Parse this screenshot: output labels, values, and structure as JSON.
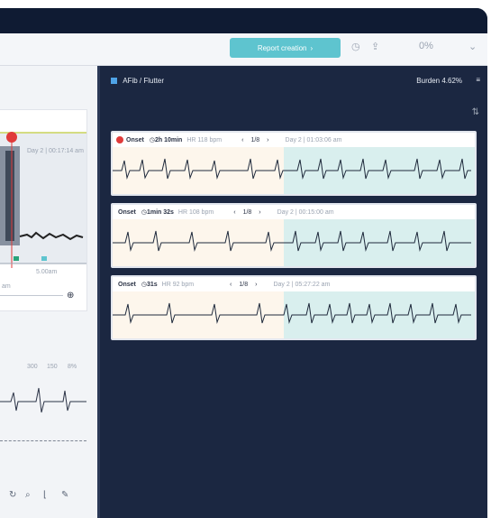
{
  "toolbar": {
    "report_button": "Report creation",
    "zoom": "0%"
  },
  "left_panel": {
    "timestamp": "Day 2 | 00:17:14 am",
    "scale_label": "5.00am",
    "axis_label": "am",
    "ticks": [
      "300",
      "150",
      "8%"
    ]
  },
  "right_panel": {
    "title": "AFib / Flutter",
    "burden": "Burden 4.62%"
  },
  "strips": [
    {
      "onset": "Onset",
      "duration": "2h 10min",
      "hr": "HR 118 bpm",
      "page": "1/8",
      "date": "Day 2 | 01:03:06 am"
    },
    {
      "onset": "Onset",
      "duration": "1min 32s",
      "hr": "HR 108 bpm",
      "page": "1/8",
      "date": "Day 2 | 00:15:00 am"
    },
    {
      "onset": "Onset",
      "duration": "31s",
      "hr": "HR 92 bpm",
      "page": "1/8",
      "date": "Day 2 | 05:27:22 am"
    }
  ],
  "colors": {
    "accent": "#5ec4cf",
    "panel": "#1b2741",
    "alert": "#e03a3a"
  }
}
